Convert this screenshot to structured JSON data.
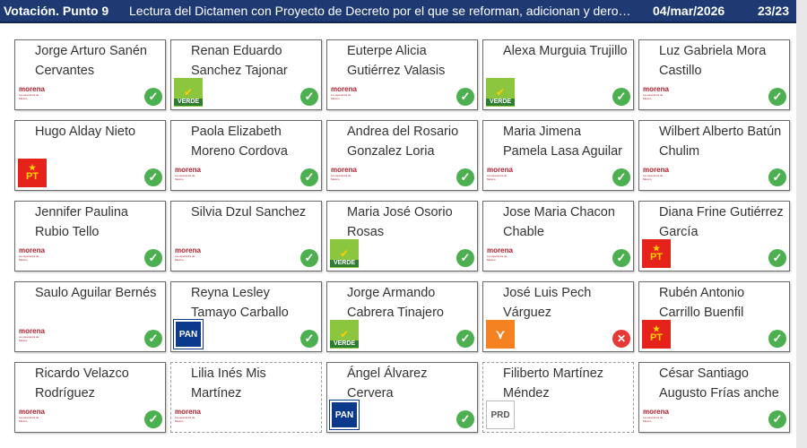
{
  "header": {
    "point_label": "Votación. Punto 9",
    "title": "Lectura del Dictamen con Proyecto de Decreto por el que se reforman, adicionan y deroga...",
    "date": "04/mar/2026",
    "count": "23/23"
  },
  "party_labels": {
    "morena": "morena",
    "morena_sub": "La esperanza de México",
    "pt": "PT",
    "verde": "VERDE",
    "pan": "PAN",
    "prd": "PRD"
  },
  "vote_glyphs": {
    "yes": "✓",
    "no": "✕"
  },
  "colors": {
    "header_bg": "#1f3a73",
    "yes": "#4caf50",
    "no": "#e53935",
    "morena": "#b01e2b",
    "pt": "#e5231b",
    "verde": "#8cc63f",
    "pan": "#0b3a8c",
    "mc": "#f58220"
  },
  "legislators": [
    {
      "name": "Jorge Arturo Sanén Cervantes",
      "party": "morena",
      "vote": "yes"
    },
    {
      "name": "Renan Eduardo Sanchez Tajonar",
      "party": "verde",
      "vote": "yes"
    },
    {
      "name": "Euterpe Alicia Gutiérrez Valasis",
      "party": "morena",
      "vote": "yes"
    },
    {
      "name": "Alexa Murguia Trujillo",
      "party": "verde",
      "vote": "yes"
    },
    {
      "name": "Luz Gabriela Mora Castillo",
      "party": "morena",
      "vote": "yes"
    },
    {
      "name": "Hugo Alday Nieto",
      "party": "pt",
      "vote": "yes"
    },
    {
      "name": "Paola Elizabeth Moreno Cordova",
      "party": "morena",
      "vote": "yes"
    },
    {
      "name": "Andrea del Rosario Gonzalez Loria",
      "party": "morena",
      "vote": "yes"
    },
    {
      "name": "Maria Jimena Pamela Lasa Aguilar",
      "party": "morena",
      "vote": "yes"
    },
    {
      "name": "Wilbert Alberto Batún Chulim",
      "party": "morena",
      "vote": "yes"
    },
    {
      "name": "Jennifer Paulina Rubio Tello",
      "party": "morena",
      "vote": "yes"
    },
    {
      "name": "Silvia Dzul Sanchez",
      "party": "morena",
      "vote": "yes"
    },
    {
      "name": "Maria José Osorio Rosas",
      "party": "verde",
      "vote": "yes"
    },
    {
      "name": "Jose Maria Chacon Chable",
      "party": "morena",
      "vote": "yes"
    },
    {
      "name": "Diana Frine Gutiérrez García",
      "party": "pt",
      "vote": "yes"
    },
    {
      "name": "Saulo Aguilar Bernés",
      "party": "morena",
      "vote": "yes"
    },
    {
      "name": "Reyna Lesley Tamayo Carballo",
      "party": "pan",
      "vote": "yes"
    },
    {
      "name": "Jorge Armando Cabrera Tinajero",
      "party": "verde",
      "vote": "yes"
    },
    {
      "name": "José Luis Pech Várguez",
      "party": "mc",
      "vote": "no"
    },
    {
      "name": "Rubén Antonio Carrillo Buenfil",
      "party": "pt",
      "vote": "yes"
    },
    {
      "name": "Ricardo Velazco Rodríguez",
      "party": "morena",
      "vote": "yes"
    },
    {
      "name": "Lilia Inés Mis Martínez",
      "party": "morena",
      "vote": "none"
    },
    {
      "name": "Ángel Álvarez Cervera",
      "party": "pan",
      "vote": "yes"
    },
    {
      "name": "Filiberto Martínez Méndez",
      "party": "prd",
      "vote": "none"
    },
    {
      "name": "César Santiago Augusto Frías anche",
      "party": "morena",
      "vote": "yes"
    }
  ]
}
